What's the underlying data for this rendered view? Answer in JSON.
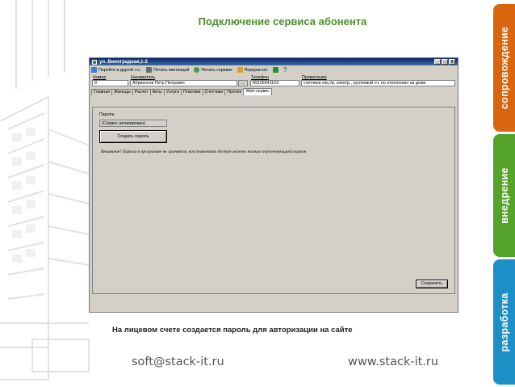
{
  "slide": {
    "title": "Подключение сервиса абонента",
    "caption": "На лицевом счете создается пароль для авторизации на сайте",
    "email": "soft@stack-it.ru",
    "website": "www.stack-it.ru"
  },
  "side_tabs": [
    "сопровождение",
    "внедрение",
    "разработка"
  ],
  "colors": {
    "title": "#4f8d2a",
    "tab_orange": "#d9650f",
    "tab_green": "#56a32b",
    "tab_blue": "#1b8fc6"
  },
  "window": {
    "title": "ул. Виноградная,1-2",
    "controls": [
      "_",
      "□",
      "X"
    ],
    "toolbar": [
      {
        "label": "Перейти в другой л.с.",
        "icon": "navigate-icon"
      },
      {
        "label": "Печать квитанций",
        "icon": "print-icon"
      },
      {
        "label": "Печать справок",
        "icon": "print-doc-icon"
      },
      {
        "label": "Перерасчет",
        "icon": "recalc-icon"
      },
      {
        "label": "",
        "icon": "check-icon"
      },
      {
        "label": "",
        "icon": "help-icon"
      }
    ],
    "fields": {
      "number_label": "Номер",
      "number_value": "9",
      "tenant_label": "Наниматель",
      "tenant_value": "Абрикосов Петр Петрович",
      "browse": "...",
      "phone_label": "Телефон",
      "phone_value": "89156641163",
      "note_label": "Примечание",
      "note_value": "счетчики х/в,г/в, электр., групповой сч. по отоплению на доме"
    },
    "tabs": [
      "Главная",
      "Жильцы",
      "Расчет",
      "Акты",
      "Услуги",
      "Платежи",
      "Счетчики",
      "Прочее",
      "Web-сервис"
    ],
    "active_tab": "Web-сервис",
    "password_label": "Пароль:",
    "password_status": "(Сервис активирован)",
    "create_button": "Создать пароль",
    "warning": "Внимание! Пароли в программе не хранятся, восстановить доступ можно только перегенерацией пароля",
    "save_button": "Сохранить"
  }
}
